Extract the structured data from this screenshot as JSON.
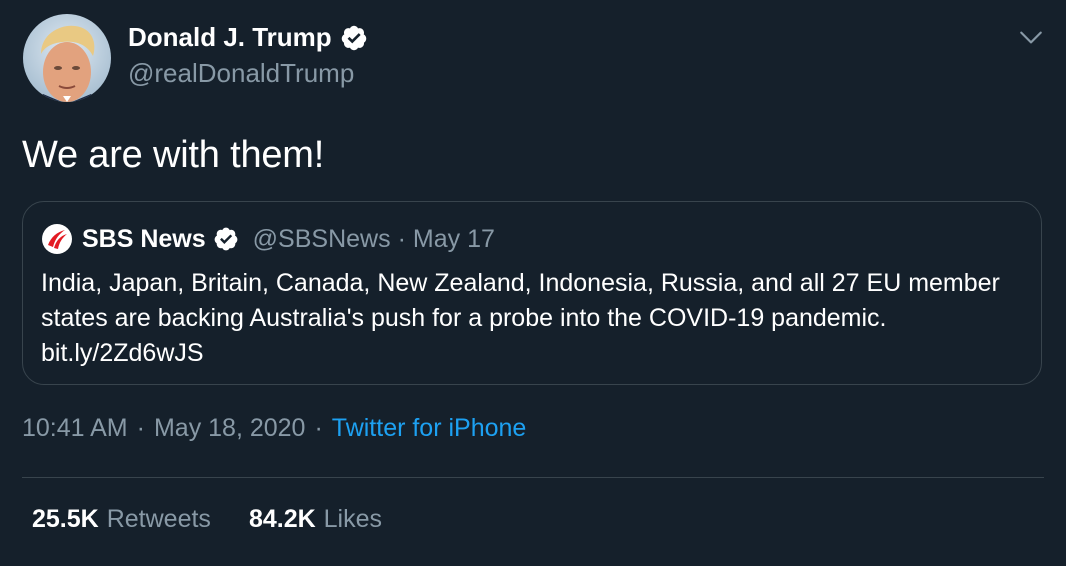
{
  "author": {
    "name": "Donald J. Trump",
    "handle": "@realDonaldTrump",
    "avatar_icon": "profile-photo",
    "verified_icon": "verified-badge-icon"
  },
  "tweet": {
    "text": "We are with them!"
  },
  "quoted": {
    "logo_icon": "sbs-logo",
    "name": "SBS News",
    "handle": "@SBSNews",
    "dot": "·",
    "date": "May 17",
    "text": "India, Japan, Britain, Canada, New Zealand, Indonesia, Russia, and all 27 EU member states are backing Australia's push for a probe into the COVID-19 pandemic. bit.ly/2Zd6wJS"
  },
  "meta": {
    "time": "10:41 AM",
    "sep": "·",
    "date": "May 18, 2020",
    "source": "Twitter for iPhone"
  },
  "stats": {
    "retweets_count": "25.5K",
    "retweets_label": "Retweets",
    "likes_count": "84.2K",
    "likes_label": "Likes"
  },
  "colors": {
    "background": "#15202b",
    "secondary_text": "#8899a6",
    "link": "#1da1f2",
    "border": "#38444d"
  }
}
